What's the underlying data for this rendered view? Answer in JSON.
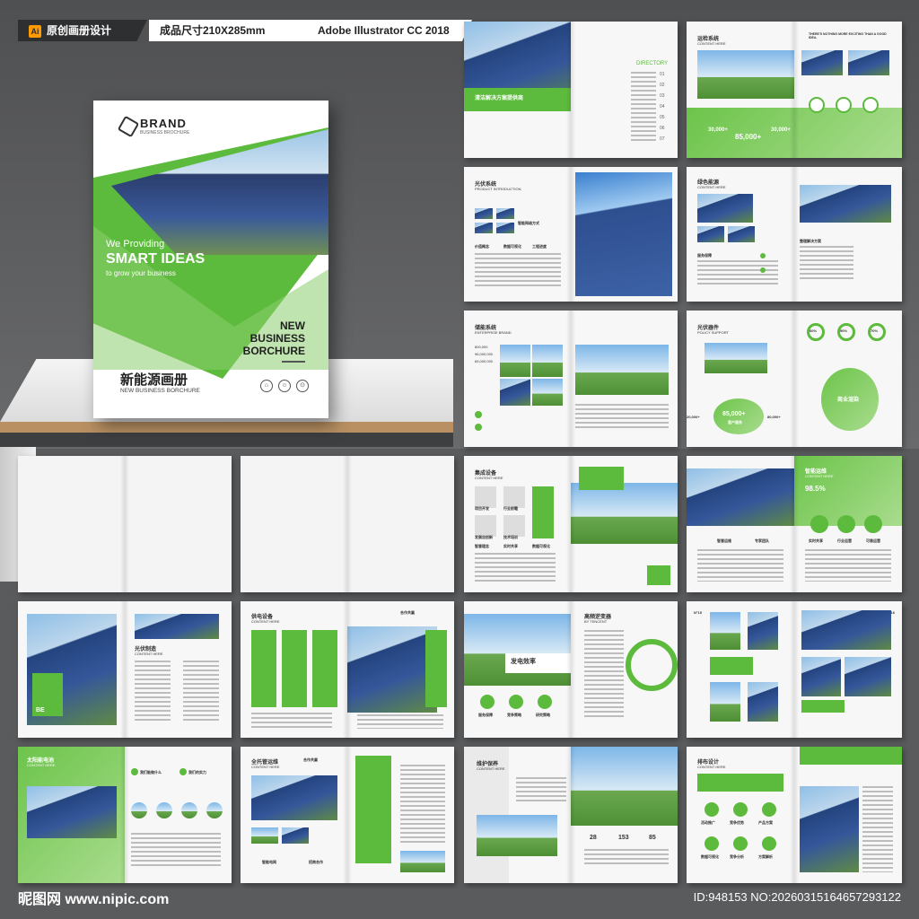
{
  "header": {
    "badge1": "原创画册设计",
    "badge1_icon": "Ai",
    "badge2": "成品尺寸210X285mm",
    "badge3": "Adobe Illustrator CC 2018"
  },
  "cover": {
    "brand": "BRAND",
    "brand_sub": "BUSINESS BROCHURE",
    "we_providing": "We Providing",
    "smart_ideas": "SMART IDEAS",
    "grow": "to grow your business",
    "new_business_lines": [
      "NEW",
      "BUSINESS",
      "BORCHURE"
    ],
    "cn_title": "新能源画册",
    "cn_sub": "NEW BUSINESS BORCHURE"
  },
  "spreads": {
    "s1": {
      "directory": "DIRECTORY",
      "items": [
        "01",
        "02",
        "03",
        "04",
        "05",
        "06",
        "07"
      ],
      "caption": "清洁解决方案提供商"
    },
    "s2": {
      "title": "运检系统",
      "sub": "CONTENT HERE",
      "tagline": "THERE'S NOTHING MORE EXCITING THAN A GOOD IDEA.",
      "stats": [
        "30,000+",
        "85,000+",
        "30,000+"
      ]
    },
    "s3": {
      "title": "光伏系统",
      "sub": "PRODUCT INTRODUCTION",
      "labels": [
        "价值概念",
        "数据可视化",
        "工程进度",
        "智能网络方式"
      ]
    },
    "s4": {
      "title": "绿色能源",
      "sub": "CONTENT HERE",
      "labels": [
        "服务保障",
        "整理解决方案"
      ]
    },
    "s5": {
      "title": "储能系统",
      "sub": "ENTERPRISE BRAND",
      "numbers": [
        "800,000",
        "96,000,000",
        "65,000,000"
      ]
    },
    "s6": {
      "title": "光伏器件",
      "sub": "POLICY SUPPORT",
      "center": "85,000+",
      "center_sub": "客户服务",
      "bubble": "商业渲染",
      "percents": [
        "60%",
        "90%",
        "70%"
      ],
      "side": [
        "20,000+",
        "80,000+"
      ]
    },
    "s7": {
      "title": "集成设备",
      "sub": "CONTENT HERE",
      "labels": [
        "项目开发",
        "行业前瞻",
        "发展自创新",
        "技术培训",
        "智慧理念",
        "实时共享",
        "数据可视化"
      ]
    },
    "s8": {
      "title": "智能运维",
      "sub": "CONTENT HERE",
      "percent": "98.5%",
      "labels": [
        "智慧运维",
        "专家团队",
        "实时共享",
        "行业运营",
        "可靠运营"
      ]
    },
    "s9": {
      "title": "光伏制造",
      "sub": "CONTENT HERE",
      "tag": "BE"
    },
    "s10": {
      "title": "供电设备",
      "sub": "CONTENT HERE",
      "top": "合作共赢"
    },
    "s11": {
      "title": "高频逆变器",
      "sub": "BY TENCENT",
      "banner": "发电效率",
      "labels": [
        "服务保障",
        "竞争策略",
        "研究策略"
      ]
    },
    "s12": {
      "no_left": "N°15",
      "no_right": "N°16"
    },
    "s13": {
      "title": "太阳能电池",
      "sub": "CONTENT HERE",
      "labels": [
        "我们能做什么",
        "我们的实力"
      ]
    },
    "s14": {
      "title": "全托管运维",
      "sub": "CONTENT HERE",
      "top": "合作共赢",
      "labels": [
        "智能电网",
        "招商合作"
      ]
    },
    "s15": {
      "title": "维护保养",
      "sub": "CONTENT HERE",
      "stats": [
        "28",
        "153",
        "85"
      ]
    },
    "s16": {
      "title": "排布设计",
      "sub": "CONTENT HERE",
      "labels": [
        "活动推广",
        "竞争优势",
        "产品方案",
        "数据可视化",
        "竞争分析",
        "方案解析"
      ]
    }
  },
  "footer": {
    "logo": "昵图网 www.nipic.com",
    "id": "ID:948153 NO:20260315164657293122"
  },
  "colors": {
    "accent": "#5cba3c",
    "dark": "#2e2f31",
    "badge_orange": "#ff9a00"
  }
}
